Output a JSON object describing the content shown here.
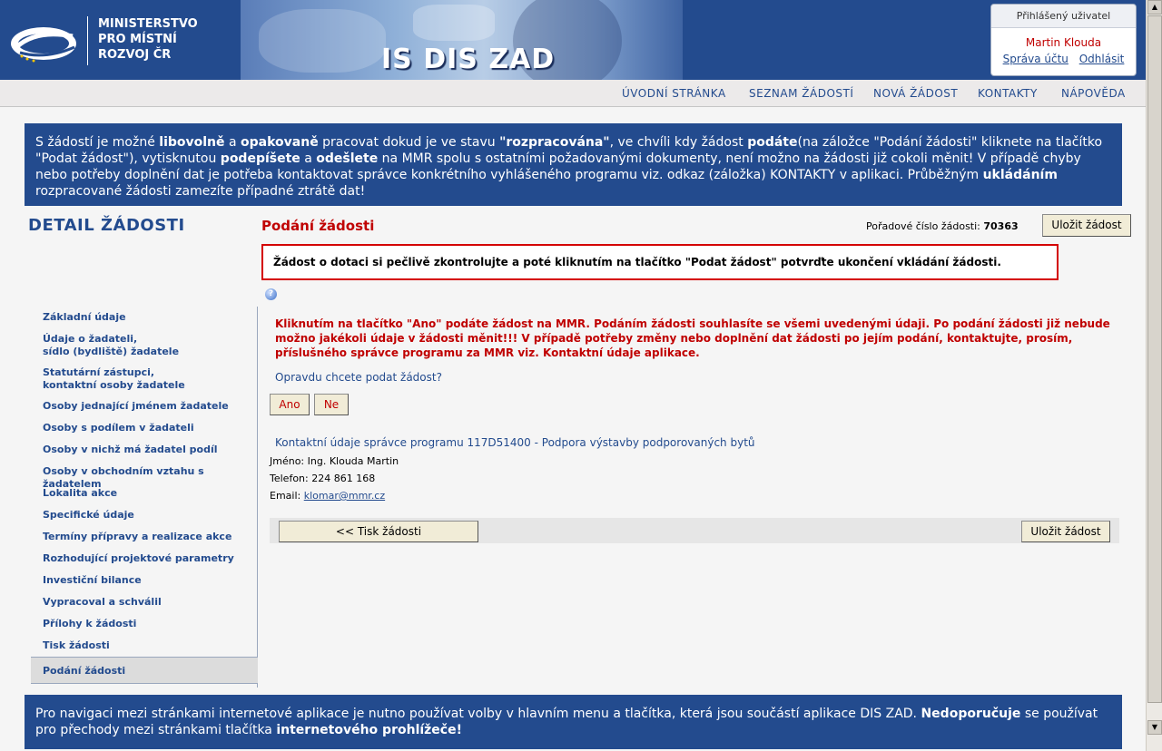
{
  "header": {
    "ministry_line1": "MINISTERSTVO",
    "ministry_line2": "PRO MÍSTNÍ",
    "ministry_line3": "ROZVOJ ČR",
    "app_title": "IS DIS ZAD"
  },
  "user_box": {
    "heading": "Přihlášený uživatel",
    "name": "Martin Klouda",
    "account_link": "Správa účtu",
    "logout_link": "Odhlásit"
  },
  "nav": {
    "home": "ÚVODNÍ STRÁNKA",
    "list": "SEZNAM ŽÁDOSTÍ",
    "new": "NOVÁ ŽÁDOST",
    "contacts": "KONTAKTY",
    "help": "NÁPOVĚDA"
  },
  "top_info": {
    "p1": "S žádostí je možné ",
    "b1": "libovolně",
    "p2": " a ",
    "b2": "opakovaně",
    "p3": " pracovat dokud je ve stavu ",
    "b3": "\"rozpracována\"",
    "p4": ", ve chvíli kdy žádost ",
    "b4": "podáte",
    "p5": "(na záložce \"Podání žádosti\" kliknete na tlačítko \"Podat žádost\"), vytisknutou ",
    "b5": "podepíšete",
    "p6": " a ",
    "b6": "odešlete",
    "p7": " na MMR spolu s ostatními požadovanými dokumenty, není možno na žádosti již cokoli měnit! V případě chyby nebo potřeby doplnění dat je potřeba kontaktovat správce konkrétního vyhlášeného programu viz. odkaz (záložka) KONTAKTY v aplikaci. Průběžným ",
    "b7": "ukládáním",
    "p8": " rozpracované žádosti zamezíte případné ztrátě dat!"
  },
  "sidebar": {
    "title": "DETAIL ŽÁDOSTI",
    "items": [
      "Základní údaje",
      "Údaje o žadateli,",
      "sídlo (bydliště) žadatele",
      "Statutární zástupci,",
      "kontaktní osoby žadatele",
      "Osoby jednající jménem žadatele",
      "Osoby s podílem v žadateli",
      "Osoby v nichž má žadatel podíl",
      "Osoby v obchodním vztahu s žadatelem",
      "Lokalita akce",
      "Specifické údaje",
      "Termíny přípravy a realizace akce",
      "Rozhodující projektové parametry",
      "Investiční bilance",
      "Vypracoval a schválil",
      "Přílohy k žádosti",
      "Tisk žádosti"
    ],
    "active": "Podání žádosti"
  },
  "main": {
    "heading": "Podání žádosti",
    "order_label": "Pořadové číslo žádosti:",
    "order_number": "70363",
    "save_label": "Uložit žádost",
    "warning": "Žádost o dotaci si pečlivě zkontrolujte a poté kliknutím na tlačítko \"Podat žádost\" potvrďte ukončení vkládání žádosti.",
    "help_glyph": "?",
    "confirm_text": "Kliknutím na tlačítko \"Ano\" podáte žádost na MMR. Podáním žádosti souhlasíte se všemi uvedenými údaji. Po podání žádosti již nebude možno jakékoli údaje v žádosti měnit!!! V případě potřeby změny nebo doplnění dat žádosti po jejím podání, kontaktujte, prosím, příslušného správce programu za MMR viz. Kontaktní údaje aplikace.",
    "question": "Opravdu chcete podat žádost?",
    "yes_label": "Ano",
    "no_label": "Ne",
    "contact_heading": "Kontaktní údaje správce programu 117D51400 - Podpora výstavby podporovaných bytů",
    "contact_name": "Jméno: Ing. Klouda Martin",
    "contact_phone": "Telefon: 224 861 168",
    "contact_email_label": "Email: ",
    "contact_email": "klomar@mmr.cz",
    "print_label": "<<  Tisk žádosti"
  },
  "bottom_info": {
    "p1": "Pro navigaci mezi stránkami internetové aplikace je nutno používat volby v hlavním menu a tlačítka, která jsou součástí aplikace DIS ZAD. ",
    "b1": "Nedoporučuje",
    "p2": " se používat pro přechody mezi stránkami tlačítka ",
    "b2": "internetového prohlížeče!",
    "p3": "."
  },
  "colors": {
    "brand_blue": "#234b8e",
    "alert_red": "#c00000",
    "button_beige": "#f1ecd7"
  }
}
